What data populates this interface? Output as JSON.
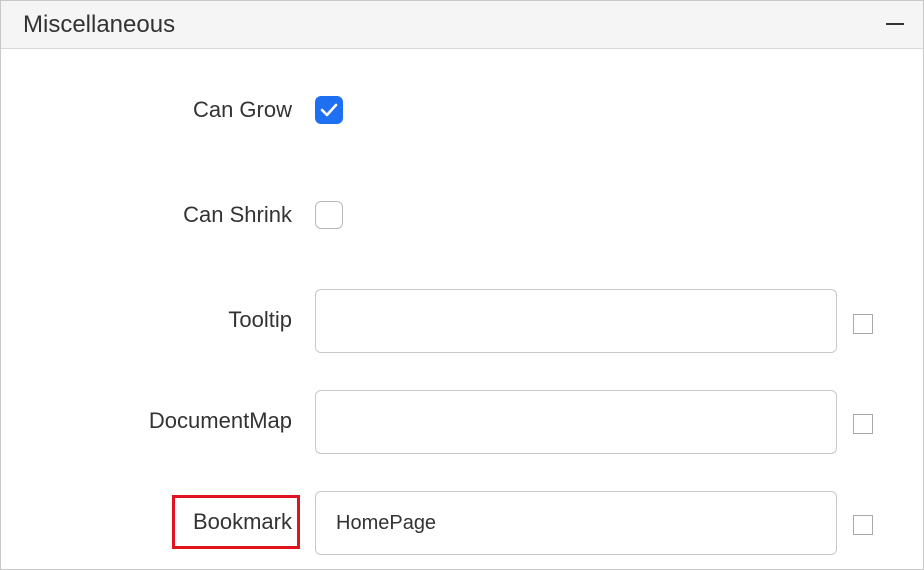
{
  "panel": {
    "title": "Miscellaneous",
    "collapse_icon": "minus-icon"
  },
  "properties": {
    "can_grow": {
      "label": "Can Grow",
      "checked": true
    },
    "can_shrink": {
      "label": "Can Shrink",
      "checked": false
    },
    "tooltip": {
      "label": "Tooltip",
      "value": ""
    },
    "document_map": {
      "label": "DocumentMap",
      "value": ""
    },
    "bookmark": {
      "label": "Bookmark",
      "value": "HomePage"
    }
  },
  "colors": {
    "accent": "#1f6ff2",
    "highlight": "#e0141e",
    "header_bg": "#f5f5f5",
    "border": "#c8c8c8"
  }
}
